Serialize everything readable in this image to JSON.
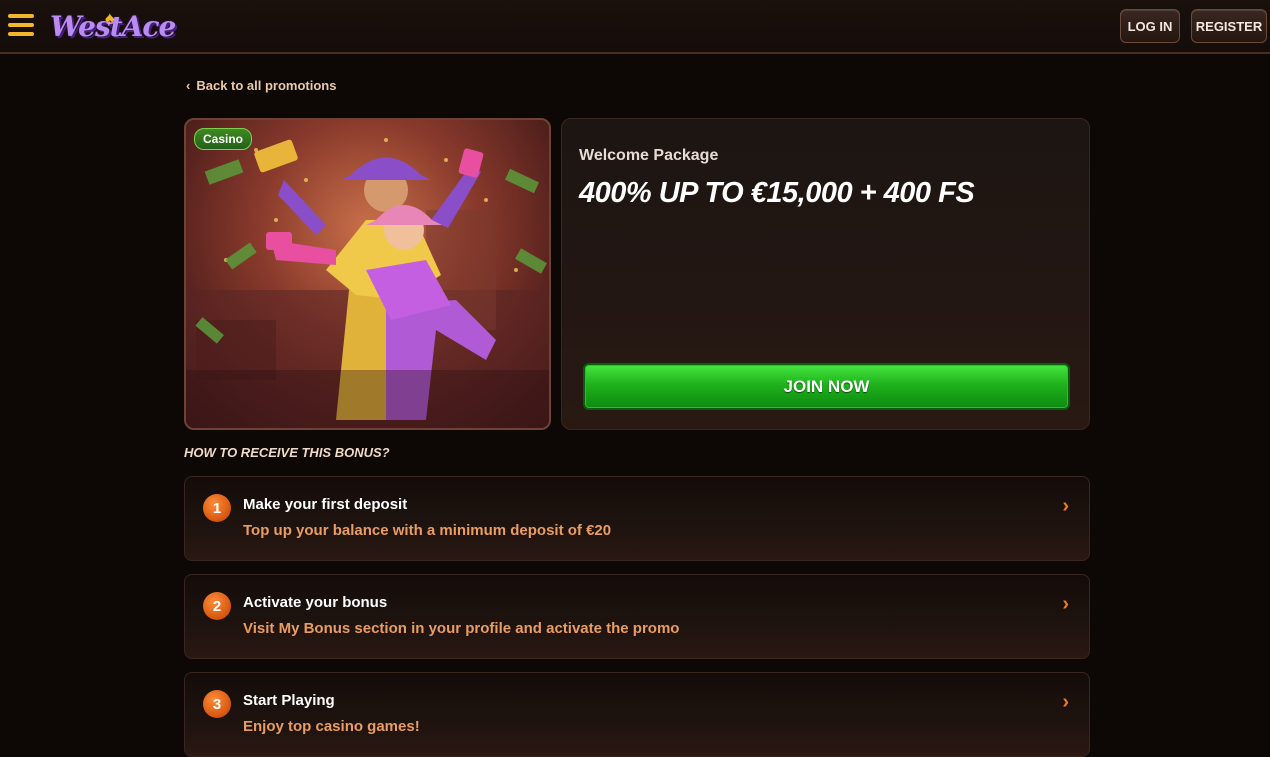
{
  "header": {
    "logo_text": "WestAce",
    "login_label": "LOG IN",
    "register_label": "REGISTER"
  },
  "back_link": {
    "label": "Back to all promotions"
  },
  "promo": {
    "badge": "Casino",
    "label": "Welcome Package",
    "title": "400% UP TO €15,000 + 400 FS",
    "join_label": "JOIN NOW"
  },
  "howto_heading": "HOW TO RECEIVE THIS BONUS?",
  "steps": [
    {
      "num": "1",
      "title": "Make your first deposit",
      "desc": "Top up your balance with a minimum deposit of €20"
    },
    {
      "num": "2",
      "title": "Activate your bonus",
      "desc": "Visit My Bonus section in your profile and activate the promo"
    },
    {
      "num": "3",
      "title": "Start Playing",
      "desc": "Enjoy top casino games!"
    }
  ],
  "colors": {
    "accent": "#f2b62c",
    "join_green": "#1fb21c",
    "step_orange": "#f07a1e",
    "background": "#0d0705"
  }
}
